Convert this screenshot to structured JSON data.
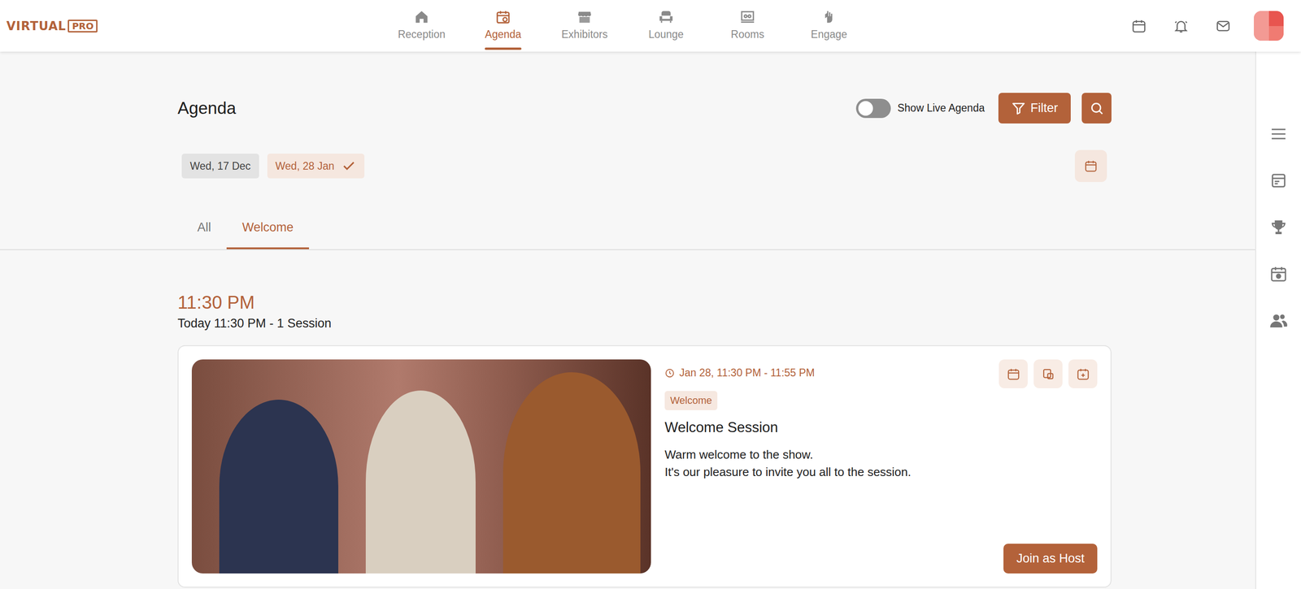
{
  "logo": {
    "text": "VIRTUAL",
    "badge": "PRO"
  },
  "nav": [
    {
      "label": "Reception",
      "selected": false
    },
    {
      "label": "Agenda",
      "selected": true
    },
    {
      "label": "Exhibitors",
      "selected": false
    },
    {
      "label": "Lounge",
      "selected": false
    },
    {
      "label": "Rooms",
      "selected": false
    },
    {
      "label": "Engage",
      "selected": false
    }
  ],
  "page": {
    "title": "Agenda"
  },
  "live_toggle": {
    "label": "Show Live Agenda",
    "on": false
  },
  "filter_button": {
    "label": "Filter"
  },
  "dates": [
    {
      "label": "Wed, 17 Dec",
      "selected": false
    },
    {
      "label": "Wed, 28 Jan",
      "selected": true
    }
  ],
  "tabs": [
    {
      "label": "All",
      "selected": false
    },
    {
      "label": "Welcome",
      "selected": true
    }
  ],
  "time_groups": [
    {
      "time": "11:30 PM",
      "summary": "Today 11:30 PM - 1 Session",
      "sessions": [
        {
          "when": "Jan 28, 11:30 PM - 11:55 PM",
          "tag": "Welcome",
          "title": "Welcome Session",
          "description": [
            "Warm welcome to the show.",
            "It's our pleasure to invite you all to the session."
          ],
          "action": "Join as Host"
        }
      ]
    }
  ]
}
